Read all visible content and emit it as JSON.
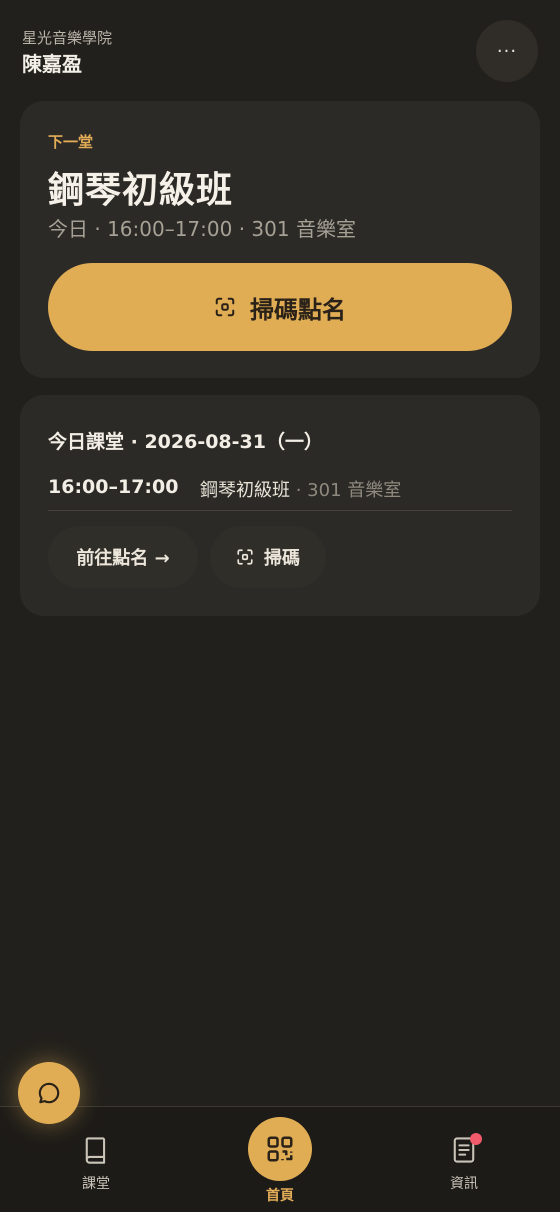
{
  "header": {
    "school": "星光音樂學院",
    "user": "陳嘉盈",
    "more_label": "···"
  },
  "next_class": {
    "label": "下一堂",
    "title": "鋼琴初級班",
    "subtitle": "今日 · 16:00–17:00 · 301 音樂室",
    "scan_button": "掃碼點名"
  },
  "today": {
    "heading": "今日課堂 · 2026-08-31（一）",
    "rows": [
      {
        "time": "16:00–17:00",
        "class": "鋼琴初級班",
        "sep": " · ",
        "room": "301 音樂室"
      }
    ],
    "go_button": "前往點名 →",
    "scan_button": "掃碼"
  },
  "tabbar": {
    "items": [
      {
        "label": "課堂",
        "icon": "book-icon"
      },
      {
        "label": "首頁",
        "icon": "qr-grid-icon"
      },
      {
        "label": "資訊",
        "icon": "news-icon"
      }
    ]
  },
  "colors": {
    "accent": "#e0ad55",
    "background": "#22201c",
    "card": "#2c2a26",
    "badge": "#f05a6a"
  }
}
